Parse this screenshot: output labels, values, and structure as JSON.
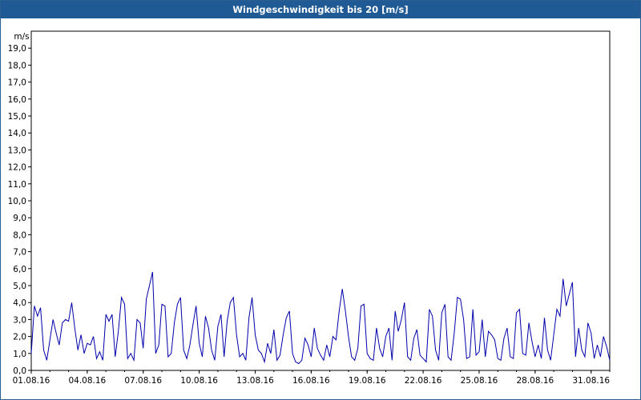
{
  "window": {
    "title": "Windgeschwindigkeit bis 20 [m/s]"
  },
  "colors": {
    "title_bar": "#1f5a94",
    "title_text": "#ffffff",
    "series": "#0000aa",
    "grid": "#000000",
    "background": "#ffffff"
  },
  "chart_data": {
    "type": "line",
    "title": "Windgeschwindigkeit bis 20 [m/s]",
    "ylabel": "m/s",
    "xlabel": "",
    "ylim": [
      0,
      20
    ],
    "xlim": [
      "2016-08-01",
      "2016-09-01"
    ],
    "grid": true,
    "y_ticks": [
      "0,0",
      "1,0",
      "2,0",
      "3,0",
      "4,0",
      "5,0",
      "6,0",
      "7,0",
      "8,0",
      "9,0",
      "10,0",
      "11,0",
      "12,0",
      "13,0",
      "14,0",
      "15,0",
      "16,0",
      "17,0",
      "18,0",
      "19,0"
    ],
    "x_ticks": [
      "01.08.16",
      "04.08.16",
      "07.08.16",
      "10.08.16",
      "13.08.16",
      "16.08.16",
      "19.08.16",
      "22.08.16",
      "25.08.16",
      "28.08.16",
      "31.08.16"
    ],
    "series": [
      {
        "x": [
          "2016-08-01 00:00",
          "2016-08-01 04:00",
          "2016-08-01 08:00",
          "2016-08-01 12:00",
          "2016-08-01 16:00",
          "2016-08-01 20:00",
          "2016-08-02 00:00",
          "2016-08-02 04:00",
          "2016-08-02 08:00",
          "2016-08-02 12:00",
          "2016-08-02 16:00",
          "2016-08-02 20:00",
          "2016-08-03 00:00",
          "2016-08-03 04:00",
          "2016-08-03 08:00",
          "2016-08-03 12:00",
          "2016-08-03 16:00",
          "2016-08-03 20:00",
          "2016-08-04 00:00",
          "2016-08-04 04:00",
          "2016-08-04 08:00",
          "2016-08-04 12:00",
          "2016-08-04 16:00",
          "2016-08-04 20:00",
          "2016-08-05 00:00",
          "2016-08-05 04:00",
          "2016-08-05 08:00",
          "2016-08-05 12:00",
          "2016-08-05 16:00",
          "2016-08-05 20:00",
          "2016-08-06 00:00",
          "2016-08-06 04:00",
          "2016-08-06 08:00",
          "2016-08-06 12:00",
          "2016-08-06 16:00",
          "2016-08-06 20:00",
          "2016-08-07 00:00",
          "2016-08-07 04:00",
          "2016-08-07 08:00",
          "2016-08-07 12:00",
          "2016-08-07 16:00",
          "2016-08-07 20:00",
          "2016-08-08 00:00",
          "2016-08-08 04:00",
          "2016-08-08 08:00",
          "2016-08-08 12:00",
          "2016-08-08 16:00",
          "2016-08-08 20:00",
          "2016-08-09 00:00",
          "2016-08-09 04:00",
          "2016-08-09 08:00",
          "2016-08-09 12:00",
          "2016-08-09 16:00",
          "2016-08-09 20:00",
          "2016-08-10 00:00",
          "2016-08-10 04:00",
          "2016-08-10 08:00",
          "2016-08-10 12:00",
          "2016-08-10 16:00",
          "2016-08-10 20:00",
          "2016-08-11 00:00",
          "2016-08-11 04:00",
          "2016-08-11 08:00",
          "2016-08-11 12:00",
          "2016-08-11 16:00",
          "2016-08-11 20:00",
          "2016-08-12 00:00",
          "2016-08-12 04:00",
          "2016-08-12 08:00",
          "2016-08-12 12:00",
          "2016-08-12 16:00",
          "2016-08-12 20:00",
          "2016-08-13 00:00",
          "2016-08-13 04:00",
          "2016-08-13 08:00",
          "2016-08-13 12:00",
          "2016-08-13 16:00",
          "2016-08-13 20:00",
          "2016-08-14 00:00",
          "2016-08-14 04:00",
          "2016-08-14 08:00",
          "2016-08-14 12:00",
          "2016-08-14 16:00",
          "2016-08-14 20:00",
          "2016-08-15 00:00",
          "2016-08-15 04:00",
          "2016-08-15 08:00",
          "2016-08-15 12:00",
          "2016-08-15 16:00",
          "2016-08-15 20:00",
          "2016-08-16 00:00",
          "2016-08-16 04:00",
          "2016-08-16 08:00",
          "2016-08-16 12:00",
          "2016-08-16 16:00",
          "2016-08-16 20:00",
          "2016-08-17 00:00",
          "2016-08-17 04:00",
          "2016-08-17 08:00",
          "2016-08-17 12:00",
          "2016-08-17 16:00",
          "2016-08-17 20:00",
          "2016-08-18 00:00",
          "2016-08-18 04:00",
          "2016-08-18 08:00",
          "2016-08-18 12:00",
          "2016-08-18 16:00",
          "2016-08-18 20:00",
          "2016-08-19 00:00",
          "2016-08-19 04:00",
          "2016-08-19 08:00",
          "2016-08-19 12:00",
          "2016-08-19 16:00",
          "2016-08-19 20:00",
          "2016-08-20 00:00",
          "2016-08-20 04:00",
          "2016-08-20 08:00",
          "2016-08-20 12:00",
          "2016-08-20 16:00",
          "2016-08-20 20:00",
          "2016-08-21 00:00",
          "2016-08-21 04:00",
          "2016-08-21 08:00",
          "2016-08-21 12:00",
          "2016-08-21 16:00",
          "2016-08-21 20:00",
          "2016-08-22 00:00",
          "2016-08-22 04:00",
          "2016-08-22 08:00",
          "2016-08-22 12:00",
          "2016-08-22 16:00",
          "2016-08-22 20:00",
          "2016-08-23 00:00",
          "2016-08-23 04:00",
          "2016-08-23 08:00",
          "2016-08-23 12:00",
          "2016-08-23 16:00",
          "2016-08-23 20:00",
          "2016-08-24 00:00",
          "2016-08-24 04:00",
          "2016-08-24 08:00",
          "2016-08-24 12:00",
          "2016-08-24 16:00",
          "2016-08-24 20:00",
          "2016-08-25 00:00",
          "2016-08-25 04:00",
          "2016-08-25 08:00",
          "2016-08-25 12:00",
          "2016-08-25 16:00",
          "2016-08-25 20:00",
          "2016-08-26 00:00",
          "2016-08-26 04:00",
          "2016-08-26 08:00",
          "2016-08-26 12:00",
          "2016-08-26 16:00",
          "2016-08-26 20:00",
          "2016-08-27 00:00",
          "2016-08-27 04:00",
          "2016-08-27 08:00",
          "2016-08-27 12:00",
          "2016-08-27 16:00",
          "2016-08-27 20:00",
          "2016-08-28 00:00",
          "2016-08-28 04:00",
          "2016-08-28 08:00",
          "2016-08-28 12:00",
          "2016-08-28 16:00",
          "2016-08-28 20:00",
          "2016-08-29 00:00",
          "2016-08-29 04:00",
          "2016-08-29 08:00",
          "2016-08-29 12:00",
          "2016-08-29 16:00",
          "2016-08-29 20:00",
          "2016-08-30 00:00",
          "2016-08-30 04:00",
          "2016-08-30 08:00",
          "2016-08-30 12:00",
          "2016-08-30 16:00",
          "2016-08-30 20:00",
          "2016-08-31 00:00",
          "2016-08-31 04:00",
          "2016-08-31 08:00",
          "2016-08-31 12:00",
          "2016-08-31 16:00",
          "2016-08-31 20:00",
          "2016-09-01 00:00"
        ],
        "y": [
          1.0,
          3.8,
          3.2,
          3.7,
          1.2,
          0.6,
          1.8,
          3.0,
          2.2,
          1.5,
          2.8,
          3.0,
          2.9,
          4.0,
          2.5,
          1.2,
          2.1,
          1.0,
          1.6,
          1.5,
          2.0,
          0.7,
          1.1,
          0.6,
          3.3,
          2.9,
          3.3,
          0.8,
          2.3,
          4.3,
          3.9,
          0.7,
          1.0,
          0.6,
          3.0,
          2.8,
          1.3,
          4.2,
          5.0,
          5.8,
          1.0,
          1.5,
          3.9,
          3.8,
          0.8,
          1.0,
          2.8,
          3.9,
          4.3,
          1.2,
          0.7,
          1.5,
          2.7,
          3.8,
          1.6,
          0.8,
          3.2,
          2.5,
          1.2,
          0.6,
          2.6,
          3.3,
          0.8,
          2.9,
          4.0,
          4.3,
          2.1,
          0.8,
          1.0,
          0.6,
          3.1,
          4.3,
          2.1,
          1.2,
          1.0,
          0.5,
          1.6,
          1.0,
          2.4,
          0.6,
          0.9,
          2.1,
          3.1,
          3.5,
          1.0,
          0.5,
          0.4,
          0.6,
          1.9,
          1.5,
          0.8,
          2.5,
          1.3,
          0.9,
          0.6,
          1.5,
          0.8,
          2.0,
          1.8,
          3.5,
          4.8,
          3.5,
          2.0,
          0.8,
          0.6,
          1.3,
          3.8,
          3.9,
          1.0,
          0.7,
          0.6,
          2.5,
          1.3,
          0.8,
          2.0,
          2.5,
          0.6,
          3.5,
          2.3,
          3.0,
          4.0,
          0.8,
          0.6,
          1.9,
          2.4,
          0.9,
          0.7,
          0.5,
          3.6,
          3.2,
          1.2,
          0.6,
          3.4,
          3.9,
          0.8,
          0.6,
          2.2,
          4.3,
          4.2,
          3.0,
          0.7,
          0.8,
          3.6,
          0.9,
          1.1,
          3.0,
          0.8,
          2.3,
          2.1,
          1.8,
          0.7,
          0.6,
          1.9,
          2.5,
          0.8,
          0.7,
          3.4,
          3.6,
          1.0,
          0.9,
          2.8,
          1.7,
          0.8,
          1.5,
          0.7,
          3.1,
          1.2,
          0.6,
          2.1,
          3.6,
          3.2,
          5.4,
          3.8,
          4.5,
          5.2,
          0.8,
          2.5,
          1.2,
          0.8,
          2.8,
          2.2,
          0.7,
          1.5,
          0.8,
          2.0,
          1.4,
          0.6
        ]
      }
    ]
  }
}
